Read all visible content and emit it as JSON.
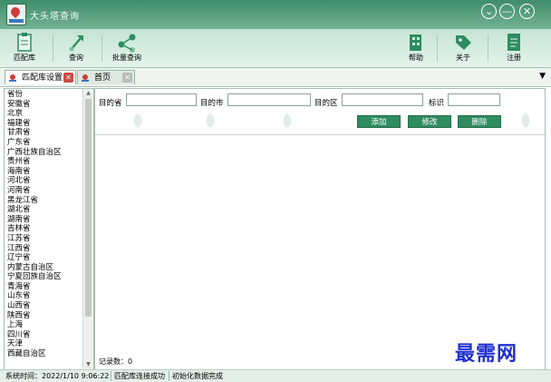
{
  "window": {
    "title": "大头塔查询",
    "colors": {
      "titlebar": "#3f8d6a",
      "toolbar": "#d6ece0",
      "button": "#2f8c61"
    }
  },
  "window_controls": {
    "dropdown": "⌄",
    "minimize": "—",
    "close": "✕"
  },
  "toolbar": {
    "library": {
      "label": "匹配库",
      "icon": "clipboard-icon"
    },
    "query": {
      "label": "查询",
      "icon": "arrow-up-right-icon"
    },
    "batch_query": {
      "label": "批量查询",
      "icon": "share-nodes-icon"
    },
    "help": {
      "label": "帮助",
      "icon": "building-icon"
    },
    "about": {
      "label": "关于",
      "icon": "tag-icon"
    },
    "register": {
      "label": "注册",
      "icon": "document-icon"
    }
  },
  "tabs": [
    {
      "label": "匹配库设置",
      "active": true
    },
    {
      "label": "首页",
      "active": false
    }
  ],
  "tab_dropdown": "▼",
  "province_list": {
    "header": "省份",
    "items": [
      "安徽省",
      "北京",
      "福建省",
      "甘肃省",
      "广东省",
      "广西壮族自治区",
      "贵州省",
      "海南省",
      "河北省",
      "河南省",
      "黑龙江省",
      "湖北省",
      "湖南省",
      "吉林省",
      "江苏省",
      "江西省",
      "辽宁省",
      "内蒙古自治区",
      "宁夏回族自治区",
      "青海省",
      "山东省",
      "山西省",
      "陕西省",
      "上海",
      "四川省",
      "天津",
      "西藏自治区"
    ]
  },
  "form": {
    "province_label": "目的省",
    "province_value": "",
    "city_label": "目的市",
    "city_value": "",
    "district_label": "目的区",
    "district_value": "",
    "mark_label": "标识",
    "mark_value": "",
    "add_button": "添加",
    "edit_button": "修改",
    "delete_button": "删除"
  },
  "record_count": "记录数：0",
  "statusbar": {
    "time": "系统时间：2022/1/10 9:06:22",
    "connection": "匹配库连接成功",
    "init": "初始化数据完成"
  },
  "watermark": "最需网"
}
